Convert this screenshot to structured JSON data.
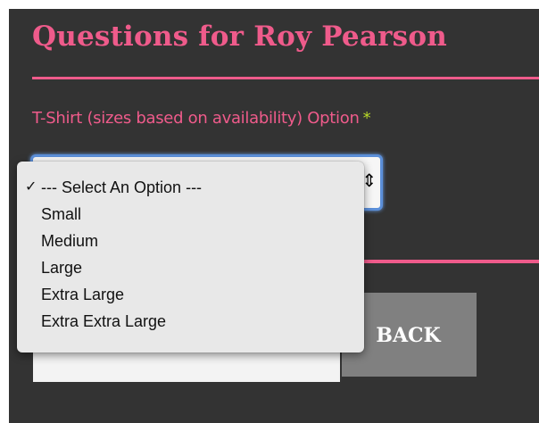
{
  "title": "Questions for Roy Pearson",
  "field": {
    "label": "T-Shirt (sizes based on availability) Option",
    "required_mark": "*",
    "selected": "--- Select An Option ---",
    "options": [
      "--- Select An Option ---",
      "Small",
      "Medium",
      "Large",
      "Extra Large",
      "Extra Extra Large"
    ]
  },
  "buttons": {
    "back_label": "BACK"
  },
  "icons": {
    "checkmark": "checkmark-icon",
    "select_arrows": "select-arrows-icon"
  },
  "colors": {
    "background": "#333333",
    "accent_pink": "#ef5b8b",
    "required_green": "#b7d827",
    "button_gray": "#808080",
    "focus_blue": "#5b8fd9"
  }
}
